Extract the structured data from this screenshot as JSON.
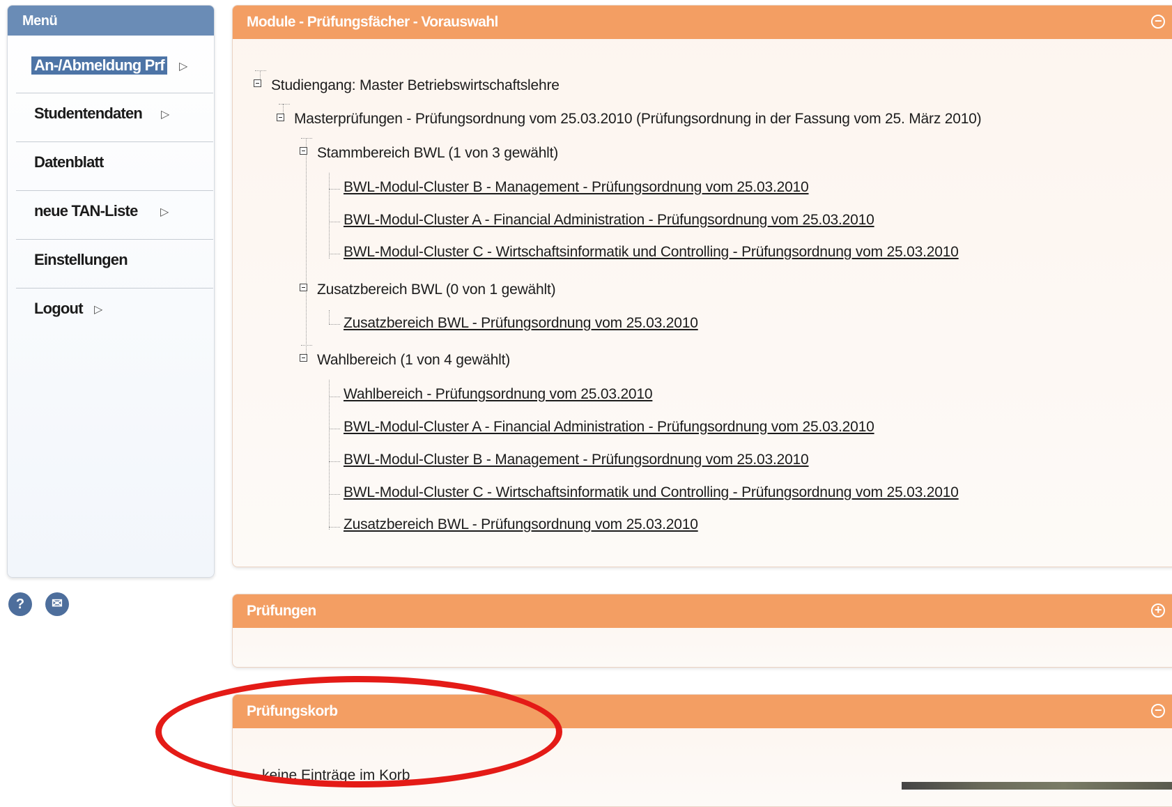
{
  "sidebar": {
    "title": "Menü",
    "items": [
      {
        "label": "An-/Abmeldung Prf",
        "arrow": "▷"
      },
      {
        "label": "Studentendaten",
        "arrow": "▷"
      },
      {
        "label": "Datenblatt",
        "arrow": ""
      },
      {
        "label": "neue TAN-Liste",
        "arrow": "▷"
      },
      {
        "label": "Einstellungen",
        "arrow": ""
      },
      {
        "label": "Logout",
        "arrow": "▷"
      }
    ],
    "help_glyph": "?",
    "mail_glyph": "✉"
  },
  "panels": {
    "module": {
      "title": "Module - Prüfungsfächer - Vorauswahl",
      "toggle": "−",
      "tree": {
        "root": "Studiengang: Master Betriebswirtschaftslehre",
        "level1": "Masterprüfungen - Prüfungsordnung vom 25.03.2010 (Prüfungsordnung in der Fassung vom 25. März 2010)",
        "groups": [
          {
            "label": "Stammbereich BWL  (1 von 3 gewählt)",
            "links": [
              "BWL-Modul-Cluster B - Management - Prüfungsordnung vom 25.03.2010",
              "BWL-Modul-Cluster A - Financial Administration - Prüfungsordnung vom 25.03.2010",
              "BWL-Modul-Cluster C - Wirtschaftsinformatik und Controlling - Prüfungsordnung vom 25.03.2010"
            ]
          },
          {
            "label": "Zusatzbereich BWL  (0 von 1 gewählt)",
            "links": [
              "Zusatzbereich BWL - Prüfungsordnung vom 25.03.2010"
            ]
          },
          {
            "label": "Wahlbereich  (1 von 4 gewählt)",
            "links": [
              "Wahlbereich - Prüfungsordnung vom 25.03.2010",
              "BWL-Modul-Cluster A - Financial Administration - Prüfungsordnung vom 25.03.2010",
              "BWL-Modul-Cluster B - Management - Prüfungsordnung vom 25.03.2010",
              "BWL-Modul-Cluster C - Wirtschaftsinformatik und Controlling - Prüfungsordnung vom 25.03.2010",
              "Zusatzbereich BWL - Prüfungsordnung vom 25.03.2010"
            ]
          }
        ]
      }
    },
    "pruefungen": {
      "title": "Prüfungen",
      "toggle": "+"
    },
    "korb": {
      "title": "Prüfungskorb",
      "toggle": "−",
      "empty_text": "keine Einträge im Korb"
    }
  },
  "colors": {
    "menu_header": "#6a8cb6",
    "menu_selected": "#4d74a6",
    "panel_header": "#f39e63",
    "annotation": "#e41b17"
  }
}
